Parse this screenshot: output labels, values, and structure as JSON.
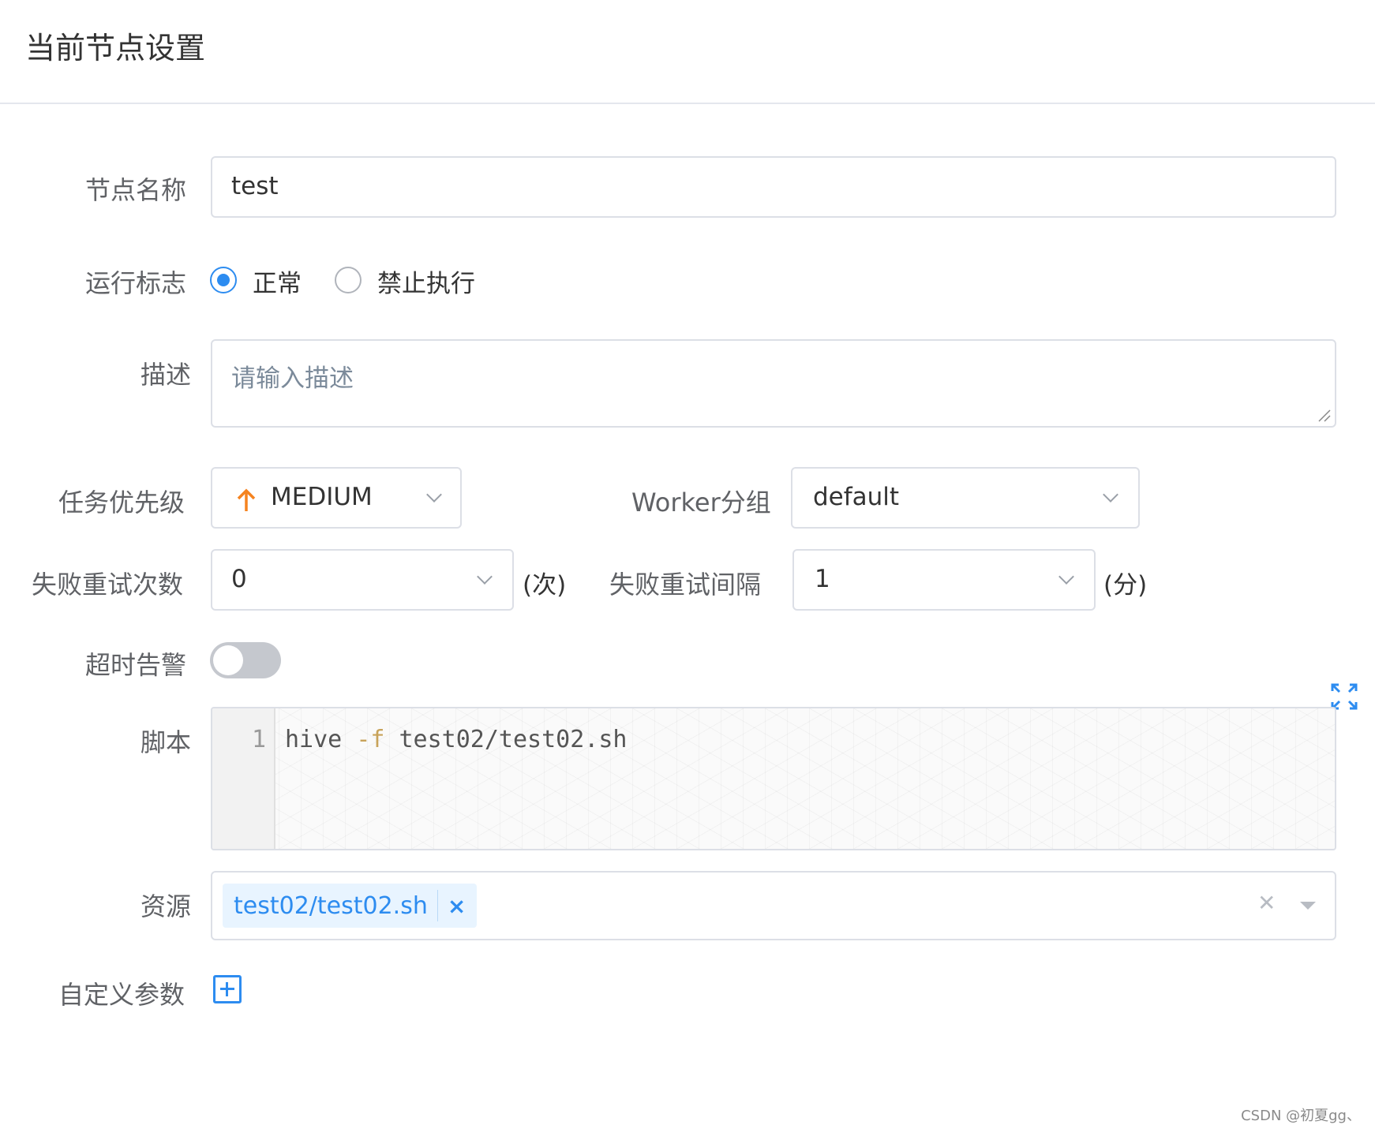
{
  "header": {
    "title": "当前节点设置"
  },
  "form": {
    "node_name": {
      "label": "节点名称",
      "value": "test"
    },
    "run_flag": {
      "label": "运行标志",
      "options": [
        "正常",
        "禁止执行"
      ],
      "selected": "正常"
    },
    "description": {
      "label": "描述",
      "placeholder": "请输入描述"
    },
    "priority": {
      "label": "任务优先级",
      "value": "MEDIUM",
      "icon": "arrow-up-icon",
      "color": "#f5831f"
    },
    "worker_group": {
      "label": "Worker分组",
      "value": "default"
    },
    "retry_times": {
      "label": "失败重试次数",
      "value": "0",
      "unit": "(次)"
    },
    "retry_interval": {
      "label": "失败重试间隔",
      "value": "1",
      "unit": "(分)"
    },
    "timeout_alarm": {
      "label": "超时告警",
      "enabled": false
    },
    "script": {
      "label": "脚本",
      "line_number": "1",
      "code_cmd": "hive ",
      "code_flag": "-f",
      "code_arg": " test02/test02.sh"
    },
    "resources": {
      "label": "资源",
      "tags": [
        "test02/test02.sh"
      ],
      "tag_close": "×",
      "clear": "✕"
    },
    "custom_params": {
      "label": "自定义参数"
    }
  },
  "watermark": "CSDN @初夏gg、",
  "colors": {
    "accent": "#2d8cf0",
    "priority_arrow": "#f5831f",
    "border": "#dcdfe6"
  }
}
